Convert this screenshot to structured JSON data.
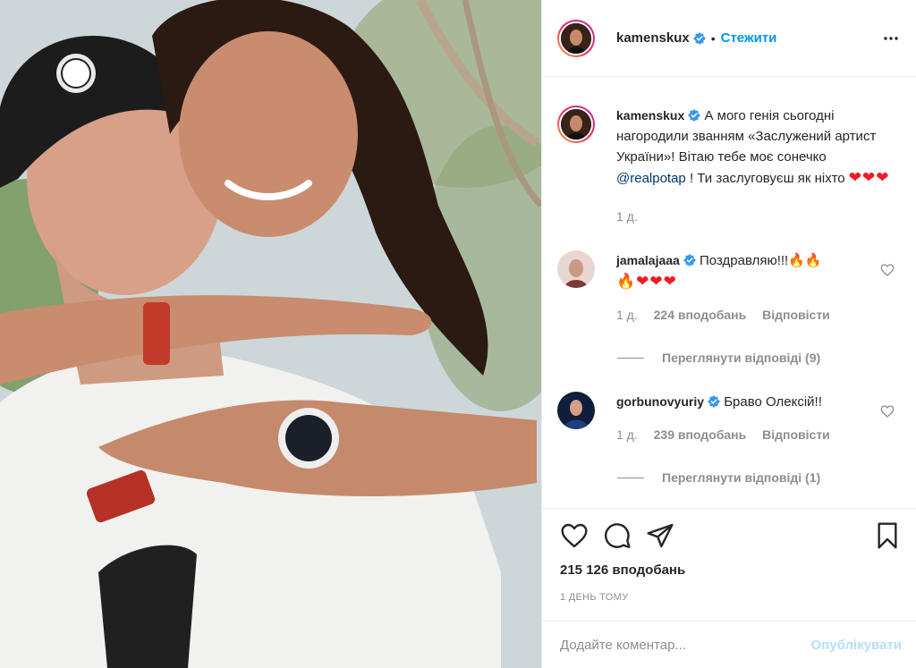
{
  "post": {
    "author": "kamenskux",
    "follow_label": "Стежити",
    "separator": "•"
  },
  "caption": {
    "author": "kamenskux",
    "text_before": "А мого генія сьогодні нагородили званням «Заслужений артист України»! Вітаю тебе моє сонечко ",
    "mention": "@realpotap",
    "text_after": " ! Ти заслуговуєш як ніхто ",
    "hearts": "❤❤❤",
    "time": "1 д."
  },
  "comments": [
    {
      "author": "jamalajaaa",
      "text": "Поздравляю!!!🔥🔥",
      "text_line2": "🔥❤❤❤",
      "time": "1 д.",
      "likes": "224 вподобань",
      "reply": "Відповісти",
      "view_replies": "Переглянути відповіді (9)"
    },
    {
      "author": "gorbunovyuriy",
      "text": "Браво Олексій!!",
      "time": "1 д.",
      "likes": "239 вподобань",
      "reply": "Відповісти",
      "view_replies": "Переглянути відповіді (1)"
    }
  ],
  "actions": {
    "likes": "215 126 вподобань",
    "time": "1 день тому"
  },
  "add_comment": {
    "placeholder": "Додайте коментар...",
    "publish": "Опублікувати"
  },
  "colors": {
    "accent": "#0095f6",
    "publish_disabled": "#b2dffc",
    "muted": "#8e8e8e",
    "heart": "#ed1c24",
    "verified": "#3897f0"
  },
  "icons": [
    "verified-badge-icon",
    "more-options-icon",
    "heart-icon",
    "comment-icon",
    "share-icon",
    "bookmark-icon"
  ]
}
